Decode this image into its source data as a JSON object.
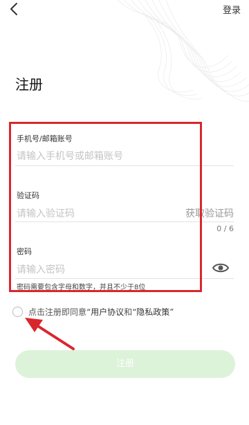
{
  "header": {
    "login_label": "登录"
  },
  "page": {
    "title": "注册"
  },
  "form": {
    "account": {
      "label": "手机号/邮箱账号",
      "placeholder": "请输入手机号或邮箱账号"
    },
    "code": {
      "label": "验证码",
      "placeholder": "请输入验证码",
      "get_code_label": "获取验证码",
      "counter": "0 / 6"
    },
    "password": {
      "label": "密码",
      "placeholder": "请输入密码",
      "hint": "密码需要包含字母和数字，并且不少于8位"
    }
  },
  "agreement": {
    "prefix": "点击注册即同意",
    "user_agreement": "“用户协议",
    "connector": "和",
    "privacy_policy": "“隐私政策”"
  },
  "register_button_label": "注册",
  "colors": {
    "annotation": "#d9262c",
    "button_bg": "#dcf3d9"
  },
  "icons": {
    "back": "chevron-left-icon",
    "password_visibility": "eye-icon"
  }
}
